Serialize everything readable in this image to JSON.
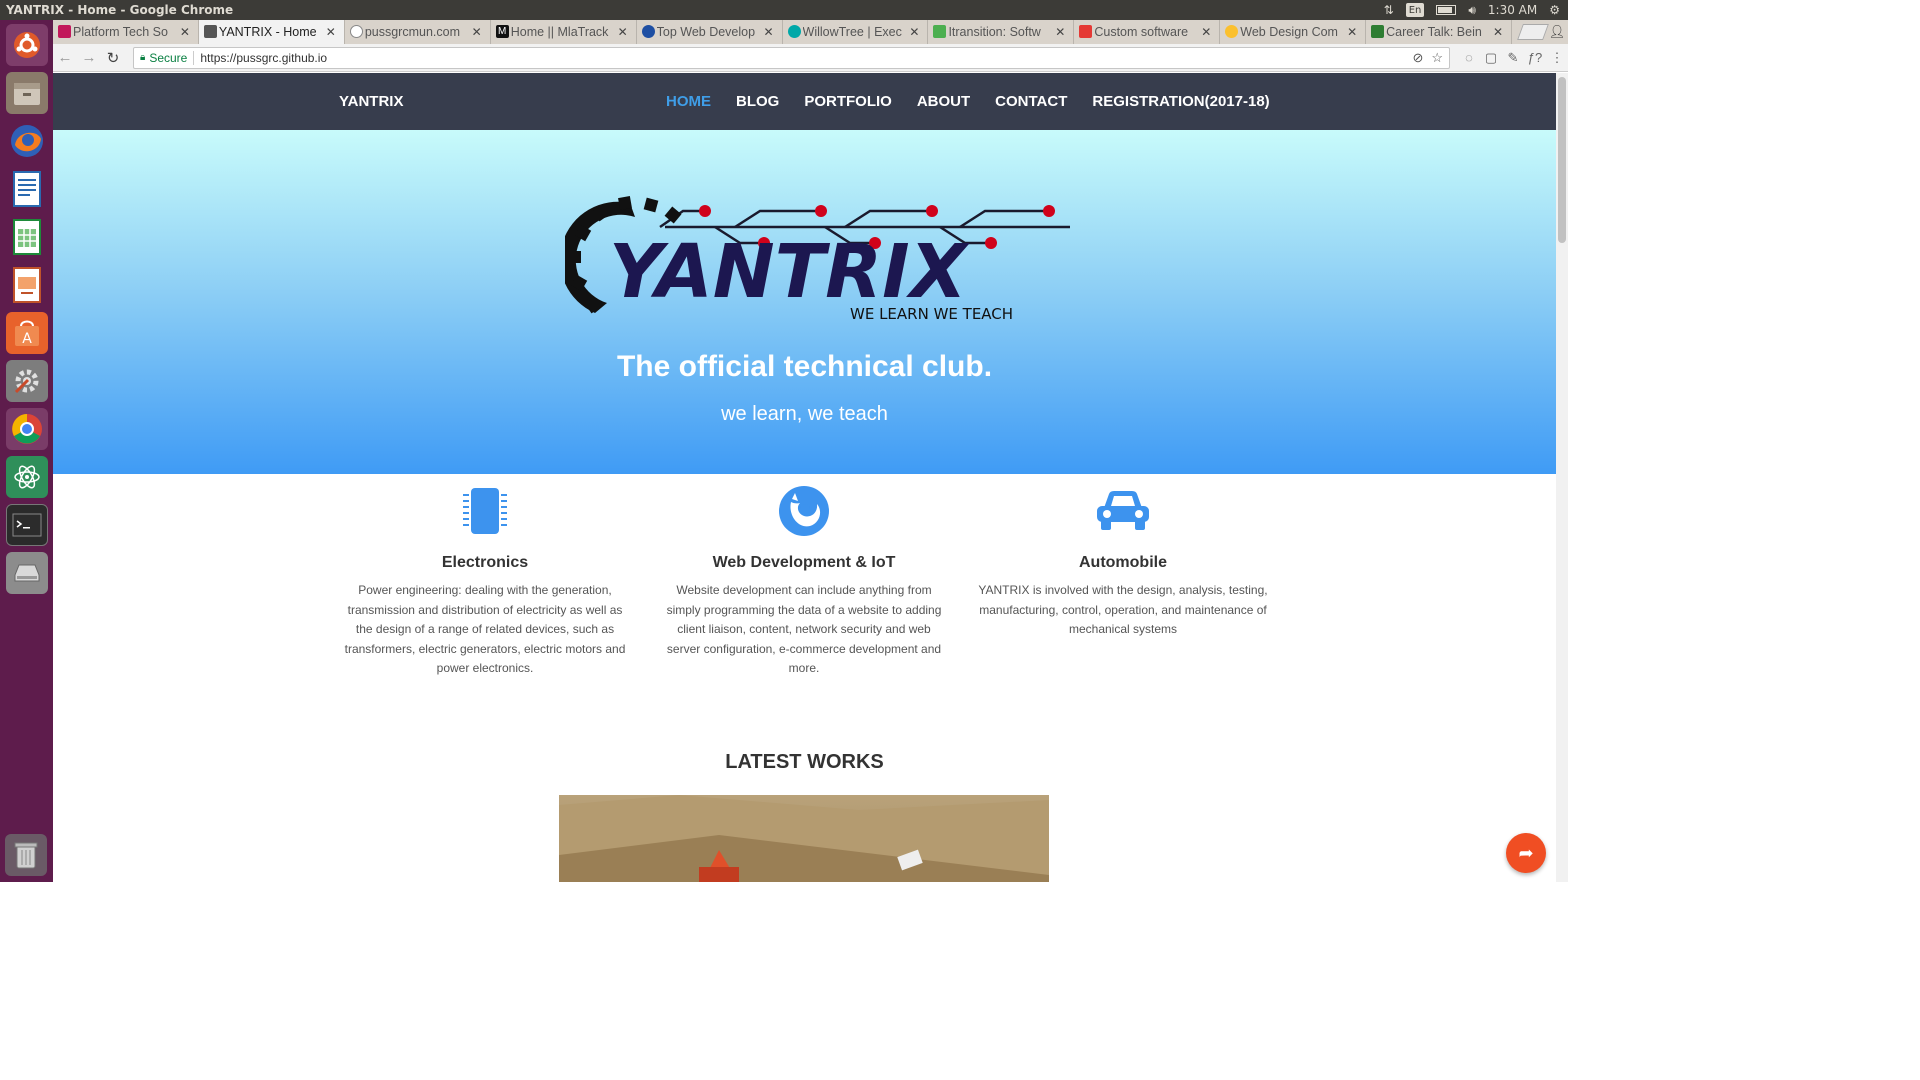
{
  "os": {
    "window_title": "YANTRIX - Home - Google Chrome",
    "keyboard_lang": "En",
    "clock": "1:30 AM"
  },
  "browser": {
    "tabs": [
      {
        "label": "Platform Tech So",
        "favicon_color": "#c2185b"
      },
      {
        "label": "YANTRIX - Home",
        "favicon_color": "#555555"
      },
      {
        "label": "pussgrcmun.com",
        "favicon_color": "#888888"
      },
      {
        "label": "Home || MlaTrack",
        "favicon_color": "#111111"
      },
      {
        "label": "Top Web Develop",
        "favicon_color": "#1e4fa3"
      },
      {
        "label": "WillowTree | Exec",
        "favicon_color": "#00a8a8"
      },
      {
        "label": "Itransition: Softw",
        "favicon_color": "#4caf50"
      },
      {
        "label": "Custom software",
        "favicon_color": "#e53935"
      },
      {
        "label": "Web Design Com",
        "favicon_color": "#fbc02d"
      },
      {
        "label": "Career Talk: Bein",
        "favicon_color": "#2e7d32"
      }
    ],
    "secure_label": "Secure",
    "url": "https://pussgrc.github.io"
  },
  "site": {
    "brand": "YANTRIX",
    "menu": [
      "HOME",
      "BLOG",
      "PORTFOLIO",
      "ABOUT",
      "CONTACT",
      "REGISTRATION(2017-18)"
    ],
    "active_menu": "HOME",
    "logo_text": "YANTRIX",
    "logo_tagline": "WE LEARN WE TEACH",
    "hero_title": "The official technical club.",
    "hero_sub": "we learn, we teach",
    "features": [
      {
        "icon": "chip-icon",
        "title": "Electronics",
        "text": "Power engineering: dealing with the generation, transmission and distribution of electricity as well as the design of a range of related devices, such as transformers, electric generators, electric motors and power electronics."
      },
      {
        "icon": "firefox-icon",
        "title": "Web Development & IoT",
        "text": "Website development can include anything from simply programming the data of a website to adding client liaison, content, network security and web server configuration, e-commerce development and more."
      },
      {
        "icon": "car-icon",
        "title": "Automobile",
        "text": "YANTRIX is involved with the design, analysis, testing, manufacturing, control, operation, and maintenance of mechanical systems"
      }
    ],
    "latest_works": "LATEST WORKS"
  },
  "colors": {
    "nav_bg": "#373d4d",
    "accent": "#3f9ee8",
    "share_button": "#f04e23",
    "launcher_bg": "#5e1c4c"
  }
}
